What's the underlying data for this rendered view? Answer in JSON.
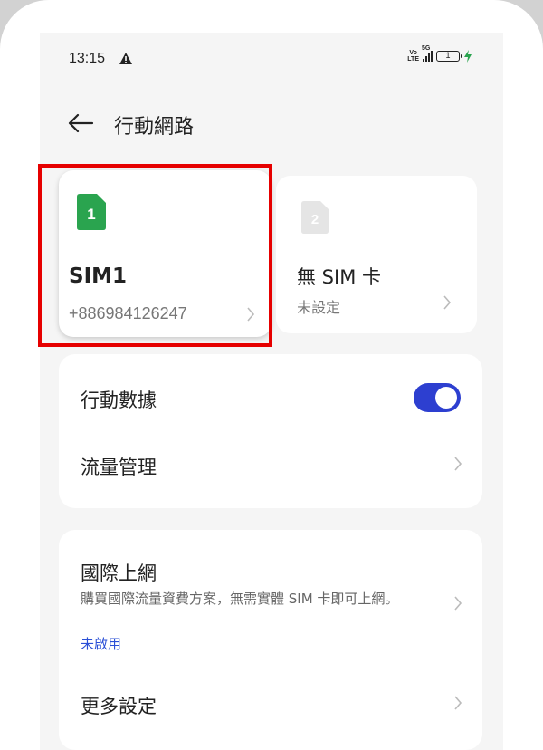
{
  "status_bar": {
    "time": "13:15",
    "volte": [
      "Vo",
      "LTE"
    ],
    "network": "5G",
    "battery": "1"
  },
  "header": {
    "title": "行動網路"
  },
  "sim_cards": [
    {
      "slot": "1",
      "name": "SIM1",
      "number": "+886984126247",
      "color": "#2aa44f"
    },
    {
      "slot": "2",
      "name": "無 SIM 卡",
      "status": "未設定",
      "color": "#e5e5e5"
    }
  ],
  "settings": {
    "mobile_data": {
      "label": "行動數據",
      "enabled": true
    },
    "data_usage": {
      "label": "流量管理"
    },
    "roaming": {
      "label": "國際上網",
      "description": "購買國際流量資費方案，無需實體 SIM 卡即可上網。",
      "status": "未啟用"
    },
    "more": {
      "label": "更多設定"
    }
  },
  "colors": {
    "accent": "#2d3fd0",
    "highlight": "#e60000",
    "link": "#2a4fd6"
  }
}
